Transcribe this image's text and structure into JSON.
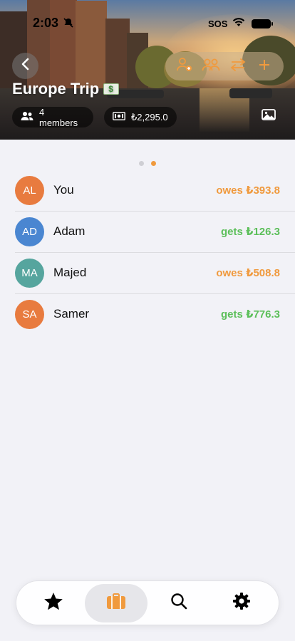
{
  "status_bar": {
    "time": "2:03",
    "sos": "SOS"
  },
  "trip": {
    "title": "Europe Trip",
    "members_label": "4 members",
    "total_label": "₺2,295.0"
  },
  "pager": {
    "count": 2,
    "active": 1
  },
  "members": [
    {
      "initials": "AL",
      "name": "You",
      "balance": "owes ₺393.8",
      "color": "#e87b3f",
      "status": "owes"
    },
    {
      "initials": "AD",
      "name": "Adam",
      "balance": "gets ₺126.3",
      "color": "#4a86d1",
      "status": "gets"
    },
    {
      "initials": "MA",
      "name": "Majed",
      "balance": "owes ₺508.8",
      "color": "#56a59e",
      "status": "owes"
    },
    {
      "initials": "SA",
      "name": "Samer",
      "balance": "gets ₺776.3",
      "color": "#e87b3f",
      "status": "gets"
    }
  ],
  "colors": {
    "owes": "#f09a3e",
    "gets": "#5cbf5a",
    "accent": "#f09a3e"
  },
  "tabbar": {
    "tabs": [
      {
        "icon": "star-icon",
        "active": false
      },
      {
        "icon": "briefcase-icon",
        "active": true
      },
      {
        "icon": "search-icon",
        "active": false
      },
      {
        "icon": "gear-icon",
        "active": false
      }
    ]
  }
}
